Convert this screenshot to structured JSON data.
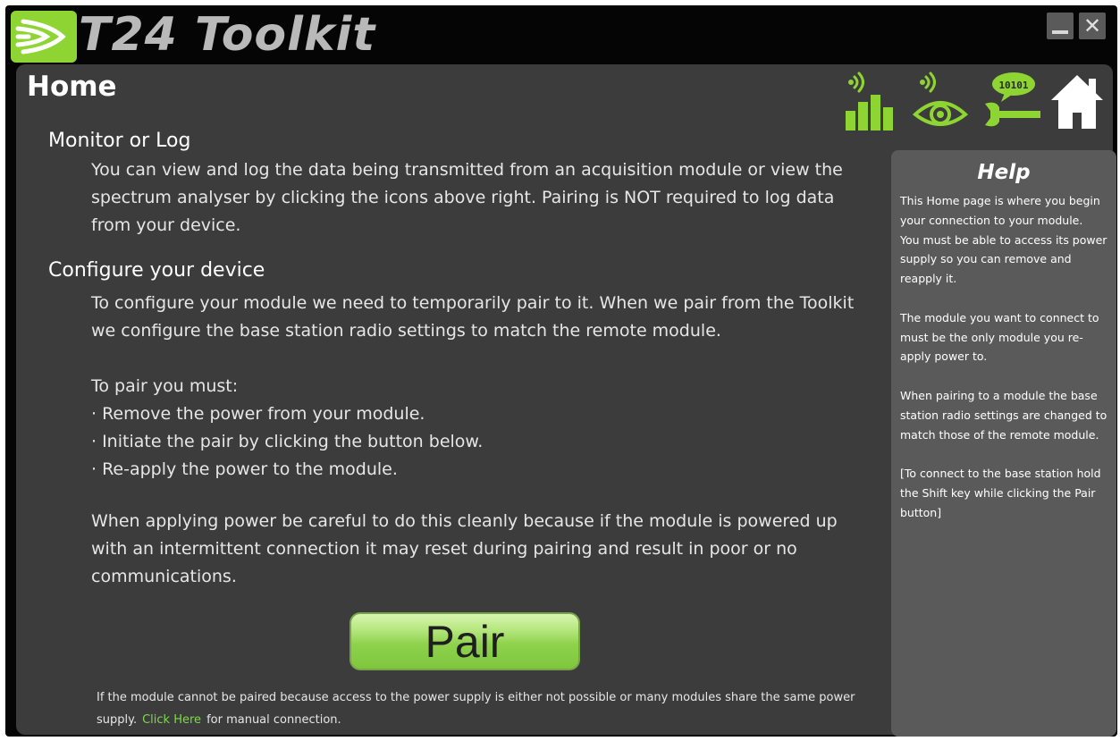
{
  "window": {
    "title": "T24 Toolkit"
  },
  "page": {
    "title": "Home"
  },
  "toolbar": {
    "icons": [
      "signal-bars-icon",
      "monitor-eye-icon",
      "config-wrench-icon",
      "home-icon"
    ],
    "config_icon_text": "10101",
    "accent_color": "#8ed534"
  },
  "monitor": {
    "heading": "Monitor or Log",
    "text": "You can view and log the data being transmitted from an acquisition module or view the spectrum analyser by clicking the icons above right. Pairing is NOT required to log data from your device."
  },
  "configure": {
    "heading": "Configure your device",
    "text": "To configure your module we need to temporarily pair to it. When we pair from the Toolkit we configure the base station radio settings to match the remote module.",
    "pair_intro": "To pair you must:",
    "steps": [
      "· Remove the power from your module.",
      "· Initiate the pair by clicking the button below.",
      "· Re-apply the power to the module."
    ],
    "power_note": "When applying power be careful to do this cleanly because if the module is powered up with an intermittent connection it may reset during pairing and result in poor or no communications."
  },
  "pair_button": {
    "label": "Pair"
  },
  "footer": {
    "text_before": "If the module cannot be paired because access to the power supply is either not possible or many modules share the same power supply.",
    "link": "Click Here",
    "text_after": "for manual connection."
  },
  "help": {
    "title": "Help",
    "body": "This Home page is where you begin your connection to your module.\n You must be able to access its power supply so you can remove and reapply it.\n\n The module you want to connect to must be the only module you re-apply power to.\n\nWhen pairing to a module the base station radio settings are changed to match those of the remote module.\n\n[To connect to the base station hold the Shift key while clicking the Pair button]"
  }
}
